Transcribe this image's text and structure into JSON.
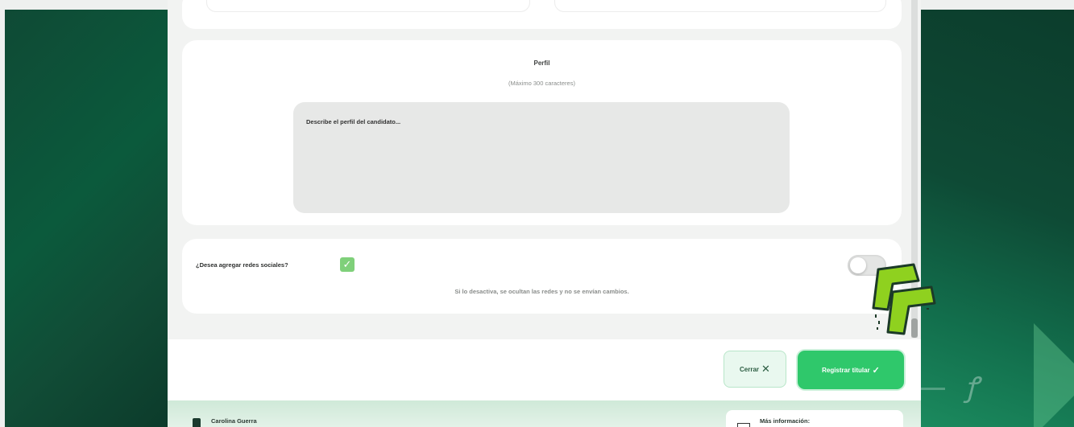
{
  "profile": {
    "title": "Perfil",
    "hint": "(Máximo 300 caracteres)",
    "placeholder": "Describe el perfil del candidato..."
  },
  "social": {
    "question": "¿Desea agregar redes sociales?",
    "checked": true,
    "note": "Si lo desactiva, se ocultan las redes y no se envían cambios.",
    "toggle_on": false
  },
  "footer": {
    "close_label": "Cerrar",
    "register_label": "Registrar titular"
  },
  "bottom": {
    "user_name": "Carolina Guerra",
    "more_label": "Más información:"
  },
  "colors": {
    "accent": "#2fc86b",
    "bg_dark_green": "#0f4a35",
    "logo_green": "#8fd11f"
  }
}
